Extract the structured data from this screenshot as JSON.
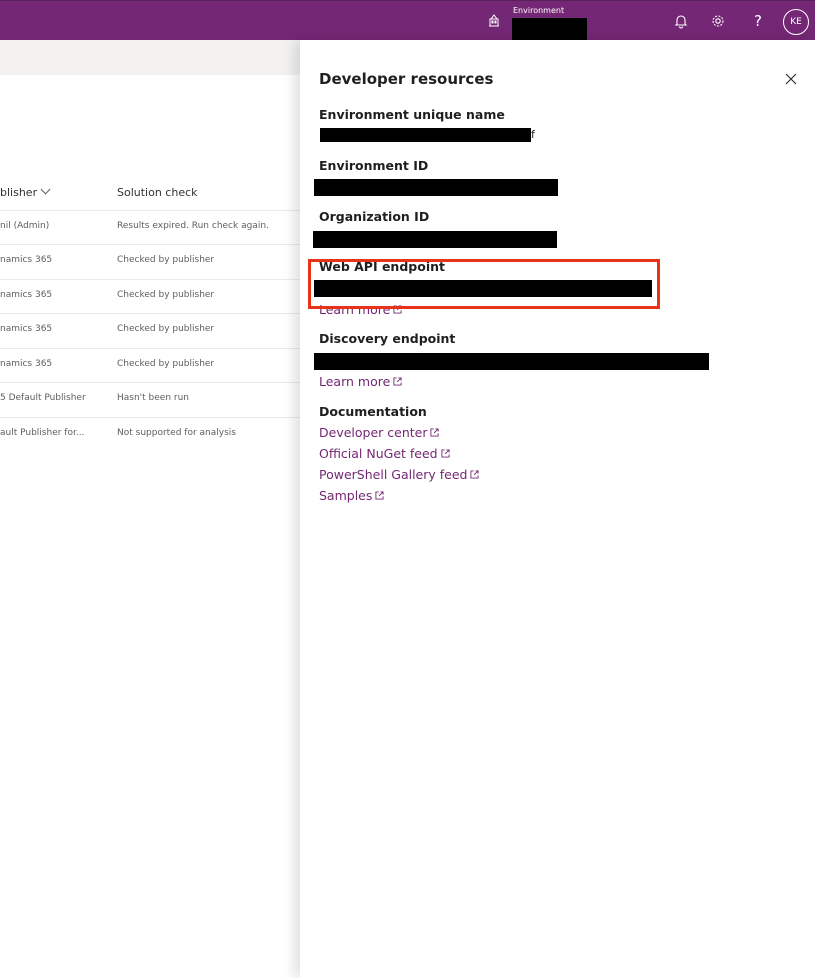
{
  "topbar": {
    "environment_label": "Environment",
    "help_glyph": "?",
    "avatar_initials": "KE",
    "icons": [
      "environment-icon",
      "bell-icon",
      "gear-icon",
      "help-icon"
    ],
    "colors": {
      "brand": "#742774"
    }
  },
  "table": {
    "columns": {
      "publisher": "blisher",
      "solution_check": "Solution check"
    },
    "rows": [
      {
        "publisher": "nil (Admin)",
        "check": "Results expired. Run check again."
      },
      {
        "publisher": "namics 365",
        "check": "Checked by publisher"
      },
      {
        "publisher": "namics 365",
        "check": "Checked by publisher"
      },
      {
        "publisher": "namics 365",
        "check": "Checked by publisher"
      },
      {
        "publisher": "namics 365",
        "check": "Checked by publisher"
      },
      {
        "publisher": "5 Default Publisher",
        "check": "Hasn't been run"
      },
      {
        "publisher": "ault Publisher for...",
        "check": "Not supported for analysis"
      }
    ]
  },
  "panel": {
    "title": "Developer resources",
    "env_unique_name_label": "Environment unique name",
    "env_unique_name_suffix": "f",
    "env_id_label": "Environment ID",
    "org_id_label": "Organization ID",
    "web_api_label": "Web API endpoint",
    "learn_more": "Learn more",
    "discovery_label": "Discovery endpoint",
    "documentation_label": "Documentation",
    "links": {
      "developer_center": "Developer center",
      "nuget": "Official NuGet feed",
      "powershell": "PowerShell Gallery feed",
      "samples": "Samples"
    },
    "colors": {
      "link": "#742774",
      "highlight": "#e8321a"
    }
  }
}
